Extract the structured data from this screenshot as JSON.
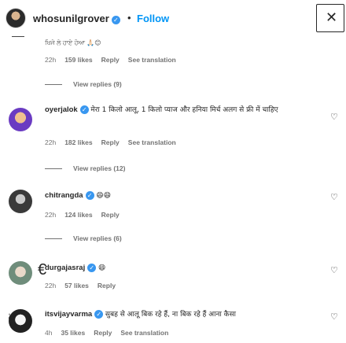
{
  "header": {
    "username": "whosunilgrover",
    "follow_label": "Follow",
    "dot": "•",
    "close_glyph": "✕"
  },
  "partial": {
    "text": "ਖਿਜੇ ਲੇ ਹਾਏ ਹੋਆ 🙏🏻😊"
  },
  "comments": [
    {
      "username": "",
      "text": "",
      "time": "22h",
      "likes": "159 likes",
      "reply": "Reply",
      "translate": "See translation",
      "view_replies": "View replies (9)"
    },
    {
      "username": "oyerjalok",
      "text": "मेरा 1 किलो आलू, 1 किलो प्याज और हनिया मिर्च अलग से फ्री में चाहिए",
      "time": "22h",
      "likes": "182 likes",
      "reply": "Reply",
      "translate": "See translation",
      "view_replies": "View replies (12)"
    },
    {
      "username": "chitrangda",
      "text": "😄😄",
      "time": "22h",
      "likes": "124 likes",
      "reply": "Reply",
      "translate": "",
      "view_replies": "View replies (6)"
    },
    {
      "username": "durgajasraj",
      "text": "😄",
      "time": "22h",
      "likes": "57 likes",
      "reply": "Reply",
      "translate": "",
      "view_replies": ""
    },
    {
      "username": "itsvijayvarma",
      "text": "सुबह से आलू बिक रहे हैं, ना बिक रहे हैं आना कैसा",
      "time": "4h",
      "likes": "35 likes",
      "reply": "Reply",
      "translate": "See translation",
      "view_replies": ""
    }
  ],
  "icons": {
    "heart": "♡",
    "side_c": "€",
    "side_hand": "✌"
  }
}
